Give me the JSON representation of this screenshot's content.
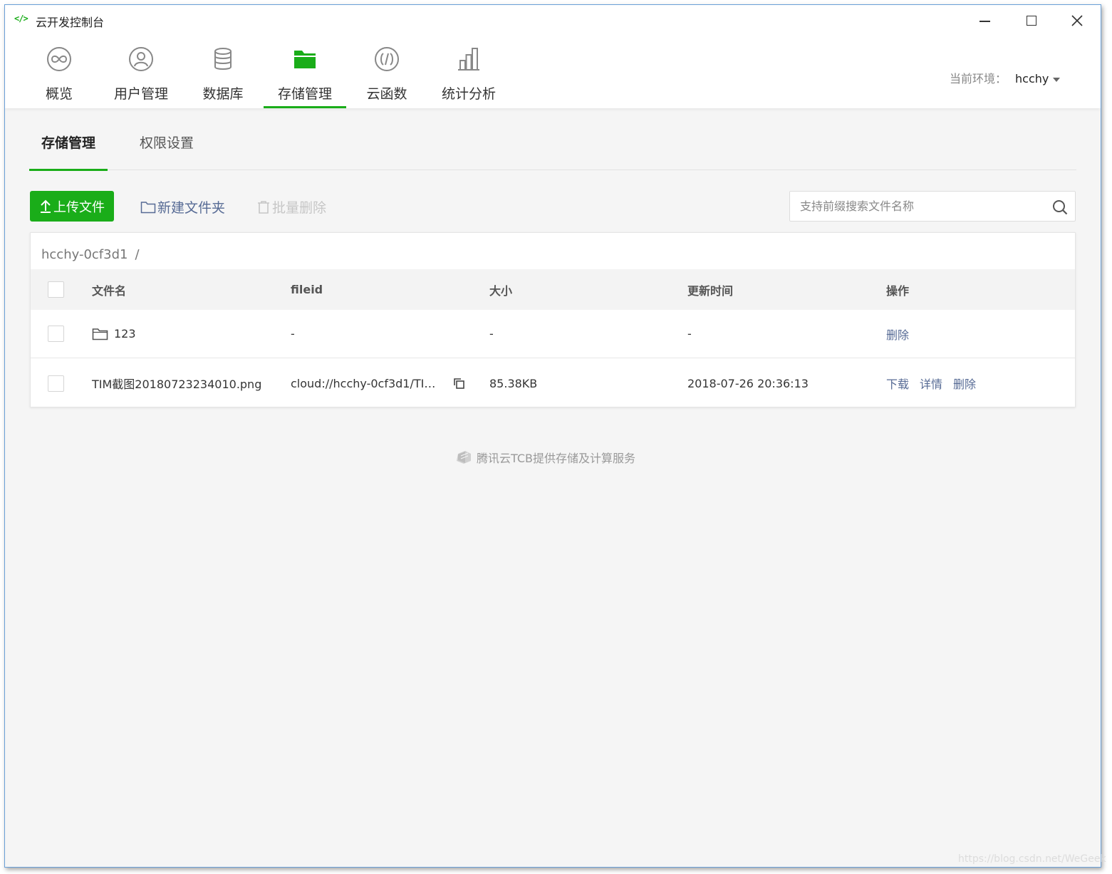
{
  "window": {
    "title": "云开发控制台"
  },
  "nav": {
    "items": [
      {
        "label": "概览",
        "icon": "overview-icon"
      },
      {
        "label": "用户管理",
        "icon": "user-icon"
      },
      {
        "label": "数据库",
        "icon": "database-icon"
      },
      {
        "label": "存储管理",
        "icon": "folder-icon",
        "active": true
      },
      {
        "label": "云函数",
        "icon": "function-icon"
      },
      {
        "label": "统计分析",
        "icon": "chart-icon"
      }
    ],
    "env_label": "当前环境：",
    "env_value": "hcchy"
  },
  "subtabs": {
    "storage": "存储管理",
    "permission": "权限设置"
  },
  "toolbar": {
    "upload": "上传文件",
    "new_folder": "新建文件夹",
    "batch_delete": "批量删除",
    "search_placeholder": "支持前缀搜索文件名称"
  },
  "breadcrumb": {
    "path": "hcchy-0cf3d1",
    "separator": "/"
  },
  "table": {
    "headers": {
      "name": "文件名",
      "fileid": "fileid",
      "size": "大小",
      "time": "更新时间",
      "ops": "操作"
    },
    "rows": [
      {
        "name": "123",
        "fileid": "-",
        "size": "-",
        "time": "-",
        "ops": [
          "删除"
        ]
      },
      {
        "name": "TIM截图20180723234010.png",
        "fileid": "cloud://hcchy-0cf3d1/TIM...",
        "size": "85.38KB",
        "time": "2018-07-26 20:36:13",
        "ops": [
          "下载",
          "详情",
          "删除"
        ]
      }
    ]
  },
  "footer": {
    "text": "腾讯云TCB提供存储及计算服务"
  },
  "watermark": "https://blog.csdn.net/WeGeek",
  "colors": {
    "accent": "#1aad19",
    "link": "#576b95"
  }
}
